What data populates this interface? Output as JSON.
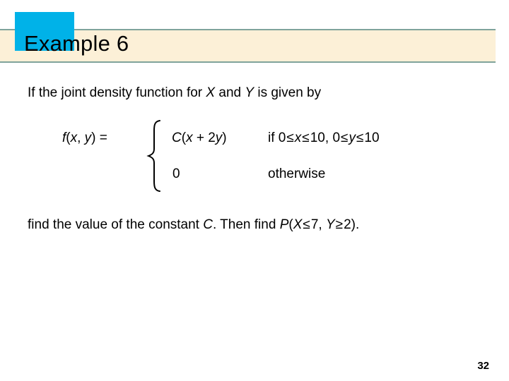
{
  "slide": {
    "title": "Example 6",
    "page_number": "32",
    "colors": {
      "header_band": "#fcf0d7",
      "header_rule": "#7fa39b",
      "accent_box": "#00b2e8",
      "text": "#000000",
      "background": "#ffffff"
    }
  },
  "body": {
    "intro": {
      "prefix": "If the joint density function for ",
      "var_x": "X",
      "middle": " and ",
      "var_y": "Y",
      "suffix": " is given by"
    },
    "piecewise": {
      "function_label": {
        "f": "f",
        "open": "(",
        "var_x": "x",
        "comma": ", ",
        "var_y": "y",
        "close": ") ="
      },
      "brace": "{",
      "cases": [
        {
          "expression": {
            "coef": "C",
            "open": "(",
            "var_x": "x",
            "plus": " + 2",
            "var_y": "y",
            "close": ")"
          },
          "condition": {
            "if": "if ",
            "lower_x": "0",
            "rel1": "≤",
            "var_x": "x",
            "rel2": "≤",
            "upper_x": "10,",
            "lower_y": "0",
            "rel3": "≤",
            "var_y": "y",
            "rel4": "≤",
            "upper_y": "10"
          }
        },
        {
          "expression": {
            "value": "0"
          },
          "condition": {
            "text": "otherwise"
          }
        }
      ]
    },
    "closing": {
      "prefix": "find the value of the constant ",
      "const_c": "C",
      "middle": ". Then find ",
      "prob_p": "P",
      "open": "(",
      "var_x": "X",
      "rel_x": "≤",
      "val_x": "7, ",
      "var_y": "Y",
      "rel_y": "≥",
      "val_y": "2",
      "close": ")."
    }
  }
}
